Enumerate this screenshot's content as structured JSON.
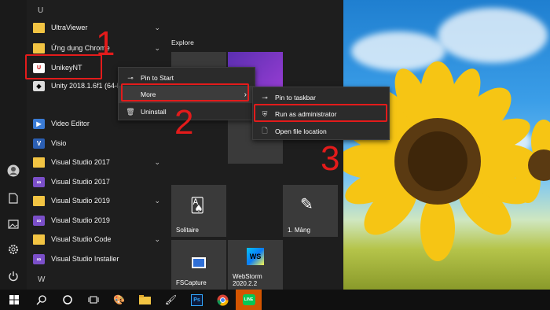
{
  "apps": {
    "section_u": "U",
    "section_w": "W",
    "items": [
      {
        "label": "UltraViewer",
        "icon": "folder-icon",
        "chevron": "⌄"
      },
      {
        "label": "Ứng dụng Chrome",
        "icon": "folder-icon",
        "chevron": "⌄"
      },
      {
        "label": "UnikeyNT",
        "icon": "unikey-icon",
        "chevron": ""
      },
      {
        "label": "Unity 2018.1.6f1 (64-bit)",
        "icon": "unity-icon",
        "chevron": ""
      },
      {
        "label": "Video Editor",
        "icon": "video-editor-icon",
        "chevron": ""
      },
      {
        "label": "Visio",
        "icon": "visio-icon",
        "chevron": ""
      },
      {
        "label": "Visual Studio 2017",
        "icon": "folder-icon",
        "chevron": "⌄"
      },
      {
        "label": "Visual Studio 2017",
        "icon": "visual-studio-icon",
        "chevron": ""
      },
      {
        "label": "Visual Studio 2019",
        "icon": "folder-icon",
        "chevron": "⌄"
      },
      {
        "label": "Visual Studio 2019",
        "icon": "visual-studio-icon",
        "chevron": ""
      },
      {
        "label": "Visual Studio Code",
        "icon": "folder-icon",
        "chevron": "⌄"
      },
      {
        "label": "Visual Studio Installer",
        "icon": "visual-studio-installer-icon",
        "chevron": ""
      }
    ]
  },
  "tiles": {
    "explore_label": "Explore",
    "solitaire_label": "Solitaire",
    "mang_label": "1. Mảng",
    "fscapture_label": "FSCapture",
    "webstorm_label": "WebStorm 2020.2.2"
  },
  "context_menu_1": {
    "pin_to_start": "Pin to Start",
    "more": "More",
    "uninstall": "Uninstall"
  },
  "context_menu_2": {
    "pin_to_taskbar": "Pin to taskbar",
    "run_as_admin": "Run as administrator",
    "open_file_location": "Open file location"
  },
  "annotations": {
    "step1": "1",
    "step2": "2",
    "step3": "3"
  },
  "colors": {
    "annotation_red": "#e31b1b",
    "active_taskbar": "#d35400"
  }
}
